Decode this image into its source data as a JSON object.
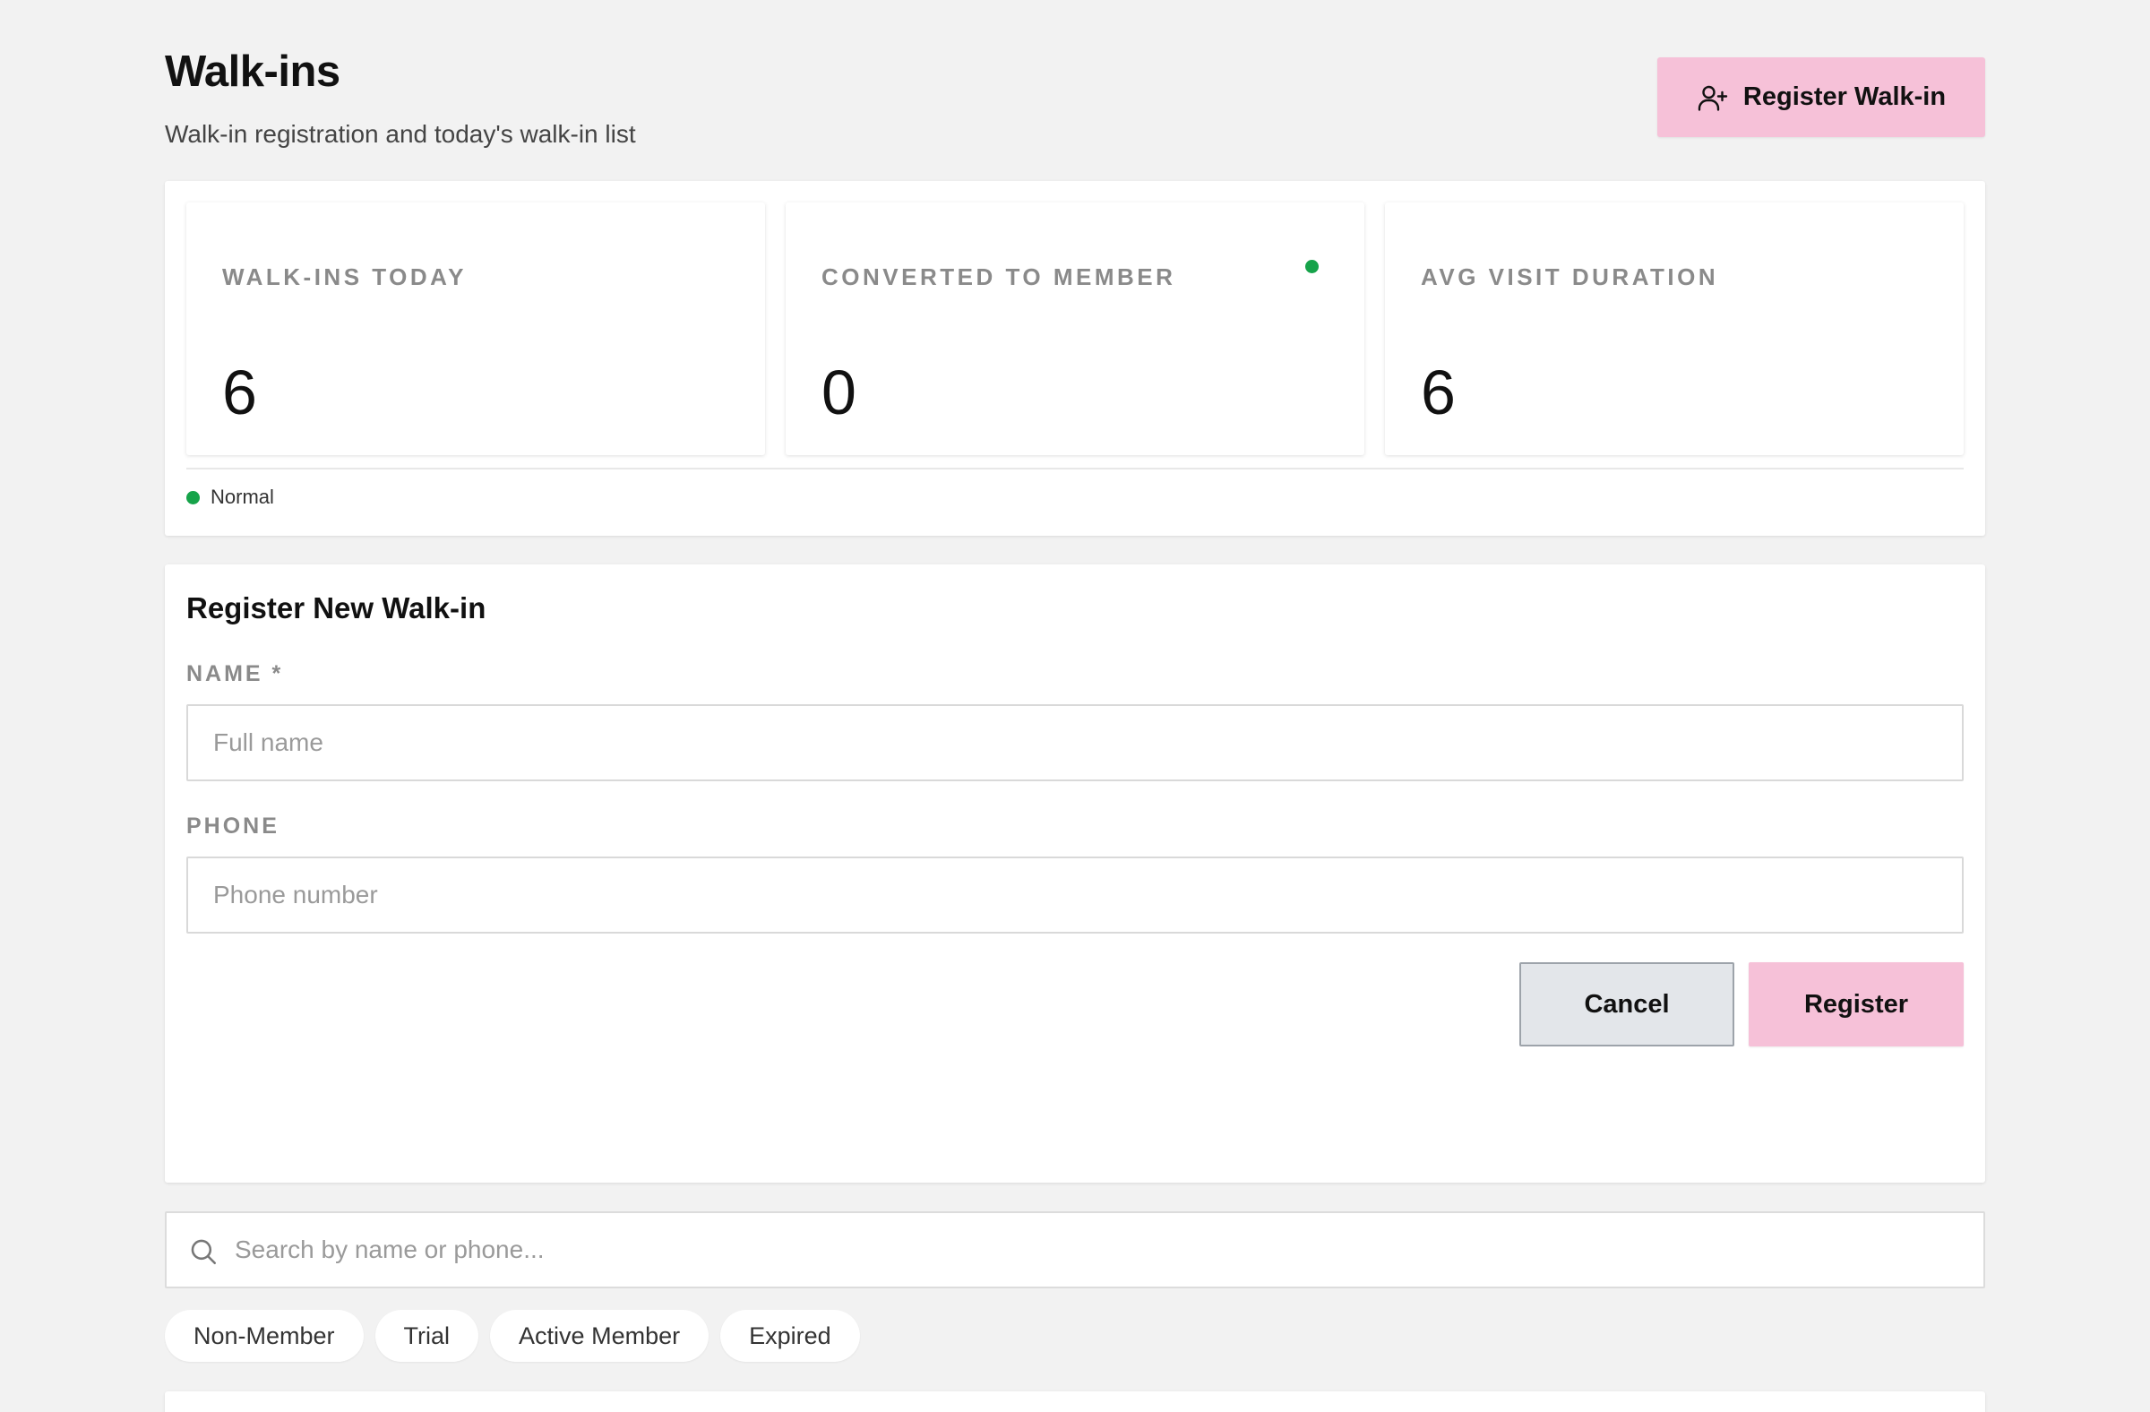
{
  "header": {
    "title": "Walk-ins",
    "subtitle": "Walk-in registration and today's walk-in list",
    "register_button": "Register Walk-in"
  },
  "stats": [
    {
      "label": "WALK-INS TODAY",
      "value": "6"
    },
    {
      "label": "CONVERTED TO MEMBER",
      "value": "0",
      "status_color": "#16a34a"
    },
    {
      "label": "AVG VISIT DURATION",
      "value": "6"
    }
  ],
  "legend": {
    "label": "Normal",
    "color": "#16a34a"
  },
  "form": {
    "title": "Register New Walk-in",
    "name_label": "NAME *",
    "name_placeholder": "Full name",
    "name_value": "",
    "phone_label": "PHONE",
    "phone_placeholder": "Phone number",
    "phone_value": "",
    "cancel_label": "Cancel",
    "register_label": "Register"
  },
  "search": {
    "placeholder": "Search by name or phone...",
    "value": ""
  },
  "filters": [
    "Non-Member",
    "Trial",
    "Active Member",
    "Expired"
  ],
  "colors": {
    "accent": "#f6c1d8",
    "background": "#f2f2f2",
    "status_green": "#16a34a"
  },
  "icons": {
    "header_button": "user-plus-icon",
    "search": "search-icon"
  }
}
